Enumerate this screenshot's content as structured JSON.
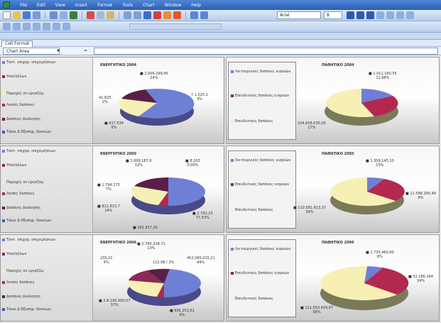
{
  "menu": [
    "File",
    "Edit",
    "View",
    "Insert",
    "Format",
    "Tools",
    "Chart",
    "Window",
    "Help"
  ],
  "toolbar": {
    "font": "Arial",
    "size": "8"
  },
  "sheet_tab": "Cell Format",
  "name_box": "Chart Area",
  "legend_left": [
    "Τακτ. επιχορ. επιχειρήσεων",
    "Υπαλλήλων",
    "Παροχές σε εργαζόμ.",
    "Λοιπές δαπάνες",
    "Δαπάνες Διοίκησης",
    "Τόκοι & Εξυπηρ. δανείων"
  ],
  "legend_right": [
    "Λειτουργικές δαπάνες εισροών",
    "Επενδυτικές δαπάνες εισροών",
    "Επενδυτικές δαπάνες"
  ],
  "charts": [
    {
      "title": "ΕΝΕΡΓΗΤΙΚΟ 2004",
      "labels": [
        "■ 2.006.299,45\n24%",
        "Ξ 1.025.1\n3%",
        "■ 617.534\n8%",
        "41.825\n2%"
      ]
    },
    {
      "title": "ΠΑΘΗΤΙΚΟ 2004",
      "labels": [
        "■ 1.011.160,55\n11,98%",
        "104.658.035,00\n17%"
      ]
    },
    {
      "title": "ΕΝΕΡΓΗΤΙΚΟ 2005",
      "labels": [
        "■ 1.008.187,6\n12%",
        "■ 8.103\n0,00%",
        "■ 1.794.175\n7%",
        "■ 811.813,7\n24%",
        "■ 2.782,23\n77,53%",
        "■ 261.817,25"
      ]
    },
    {
      "title": "ΠΑΘΗΤΙΚΟ 2005",
      "labels": [
        "■ 1.309.145,10\n15%",
        "■ 110.581.613,37\n59%",
        "■ 11.588.280,48\n8%"
      ]
    },
    {
      "title": "ΕΝΕΡΓΗΤΙΚΟ 2006",
      "labels": [
        "■ 2.795.228,71\n13%",
        "235,21\n4%",
        "122.98 / 3%",
        "452.065.015,21\n44%",
        "■ 2.8.195.000,07\n37%",
        "■ 695.253,61\n6%"
      ]
    },
    {
      "title": "ΠΑΘΗΤΙΚΟ 2006",
      "labels": [
        "■ 1.735.460,00\n8%",
        "■ 111.553.439,87\n58%",
        "■ 52.186.264\n34%"
      ]
    }
  ],
  "colors": {
    "slice_blue": "#6f7fd6",
    "slice_cream": "#f7f0b5",
    "slice_maroon": "#8b2a55",
    "slice_crimson": "#b3284f",
    "slice_dark": "#5a1f47",
    "slice_side": "#8a8a6a"
  }
}
